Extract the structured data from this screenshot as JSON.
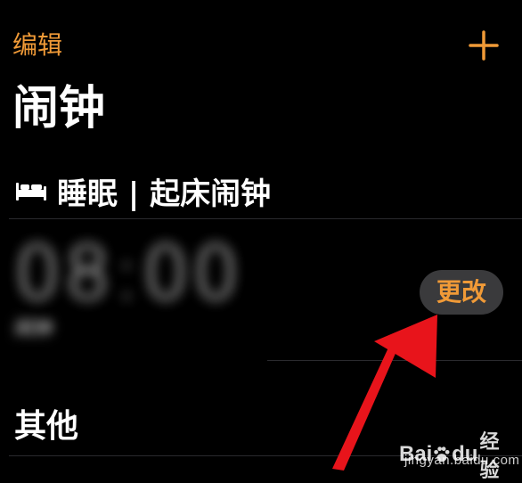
{
  "nav": {
    "edit_label": "编辑",
    "add_icon": "plus-icon"
  },
  "page": {
    "title": "闹钟"
  },
  "sleep_section": {
    "icon": "bed-icon",
    "header": "睡眠 | 起床闹钟",
    "alarm_time": "08:00",
    "alarm_sub": "闹钟",
    "change_label": "更改"
  },
  "other_section": {
    "header": "其他"
  },
  "annotation": {
    "arrow_color": "#e8141b"
  },
  "watermark": {
    "brand_left": "Bai",
    "brand_right": "du",
    "brand_cn": "经验",
    "url": "jingyan.baidu.com"
  },
  "colors": {
    "accent": "#f09a37",
    "background": "#000000",
    "button_bg": "#3a3a3c",
    "divider": "#2a2a2e"
  }
}
